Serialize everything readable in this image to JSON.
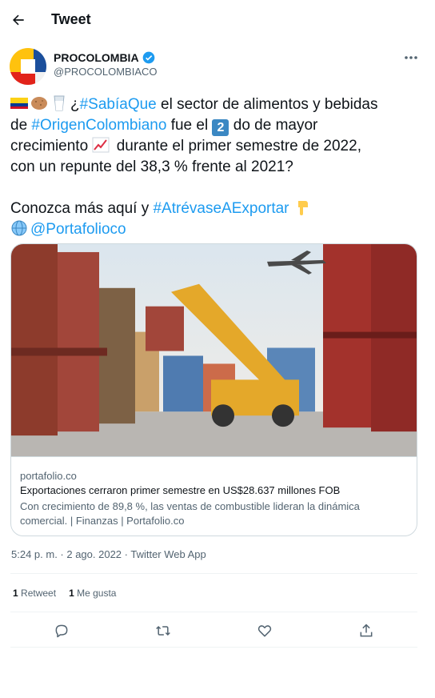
{
  "header": {
    "title": "Tweet"
  },
  "author": {
    "name": "PROCOLOMBIA",
    "handle": "@PROCOLOMBIACO"
  },
  "tweet": {
    "line1_prefix": "¿",
    "line1_tag": "#SabíaQue",
    "line1_rest": " el sector de alimentos y bebidas",
    "line2_prefix": "de ",
    "line2_tag": "#OrigenColombiano",
    "line2_mid": " fue el ",
    "line2_badge": "2",
    "line2_rest": " do de mayor",
    "line3_start": "crecimiento ",
    "line3_rest": " durante el primer semestre de 2022,",
    "line4": "con un repunte del 38,3 % frente al 2021?",
    "line5_start": "Conozca más aquí y ",
    "line5_tag": "#AtrévaseAExportar",
    "line6_mention": "@Portafolioco"
  },
  "card": {
    "domain": "portafolio.co",
    "title": "Exportaciones cerraron primer semestre en US$28.637 millones FOB",
    "description": "Con crecimiento de 89,8 %, las ventas de combustible lideran la dinámica comercial. | Finanzas | Portafolio.co"
  },
  "meta": {
    "timestamp": "5:24 p. m. · 2 ago. 2022 · Twitter Web App"
  },
  "stats": {
    "retweets_count": "1",
    "retweets_label": "Retweet",
    "likes_count": "1",
    "likes_label": "Me gusta"
  },
  "icons": [
    "back-arrow-icon",
    "verified-badge-icon",
    "more-icon",
    "reply-icon",
    "retweet-icon",
    "like-icon",
    "share-icon",
    "colombia-flag-icon",
    "potato-icon",
    "glass-of-milk-icon",
    "chart-increasing-icon",
    "backhand-index-pointing-down-icon",
    "globe-icon"
  ],
  "colors": {
    "link": "#1d9bf0",
    "text": "#0f1419",
    "secondary": "#536471",
    "border": "#cfd9de"
  }
}
